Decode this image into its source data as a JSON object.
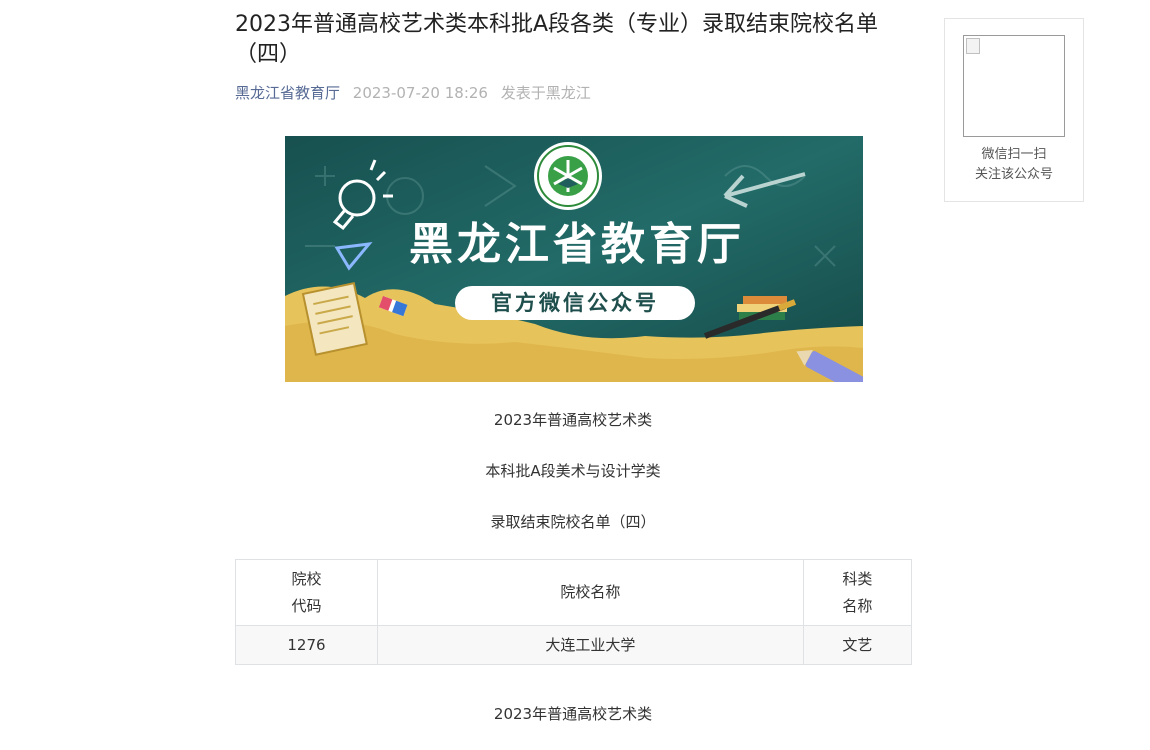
{
  "article": {
    "title": "2023年普通高校艺术类本科批A段各类（专业）录取结束院校名单（四）",
    "account": "黑龙江省教育厅",
    "date": "2023-07-20 18:26",
    "location": "发表于黑龙江"
  },
  "banner": {
    "headline": "黑龙江省教育厅",
    "subline": "官方微信公众号",
    "logo_text": "黑龙江省教育厅",
    "colors": {
      "board": "#1f5e5c",
      "sand": "#e6c35c",
      "ribbon": "#ffffff"
    }
  },
  "sections": [
    {
      "line1": "2023年普通高校艺术类",
      "line2": "本科批A段美术与设计学类",
      "line3": "录取结束院校名单（四）"
    }
  ],
  "table": {
    "headers": [
      "院校代码",
      "院校名称",
      "科类名称"
    ],
    "rows": [
      [
        "1276",
        "大连工业大学",
        "文艺"
      ]
    ]
  },
  "footer_heading": "2023年普通高校艺术类",
  "qr": {
    "caption_line1": "微信扫一扫",
    "caption_line2": "关注该公众号"
  }
}
